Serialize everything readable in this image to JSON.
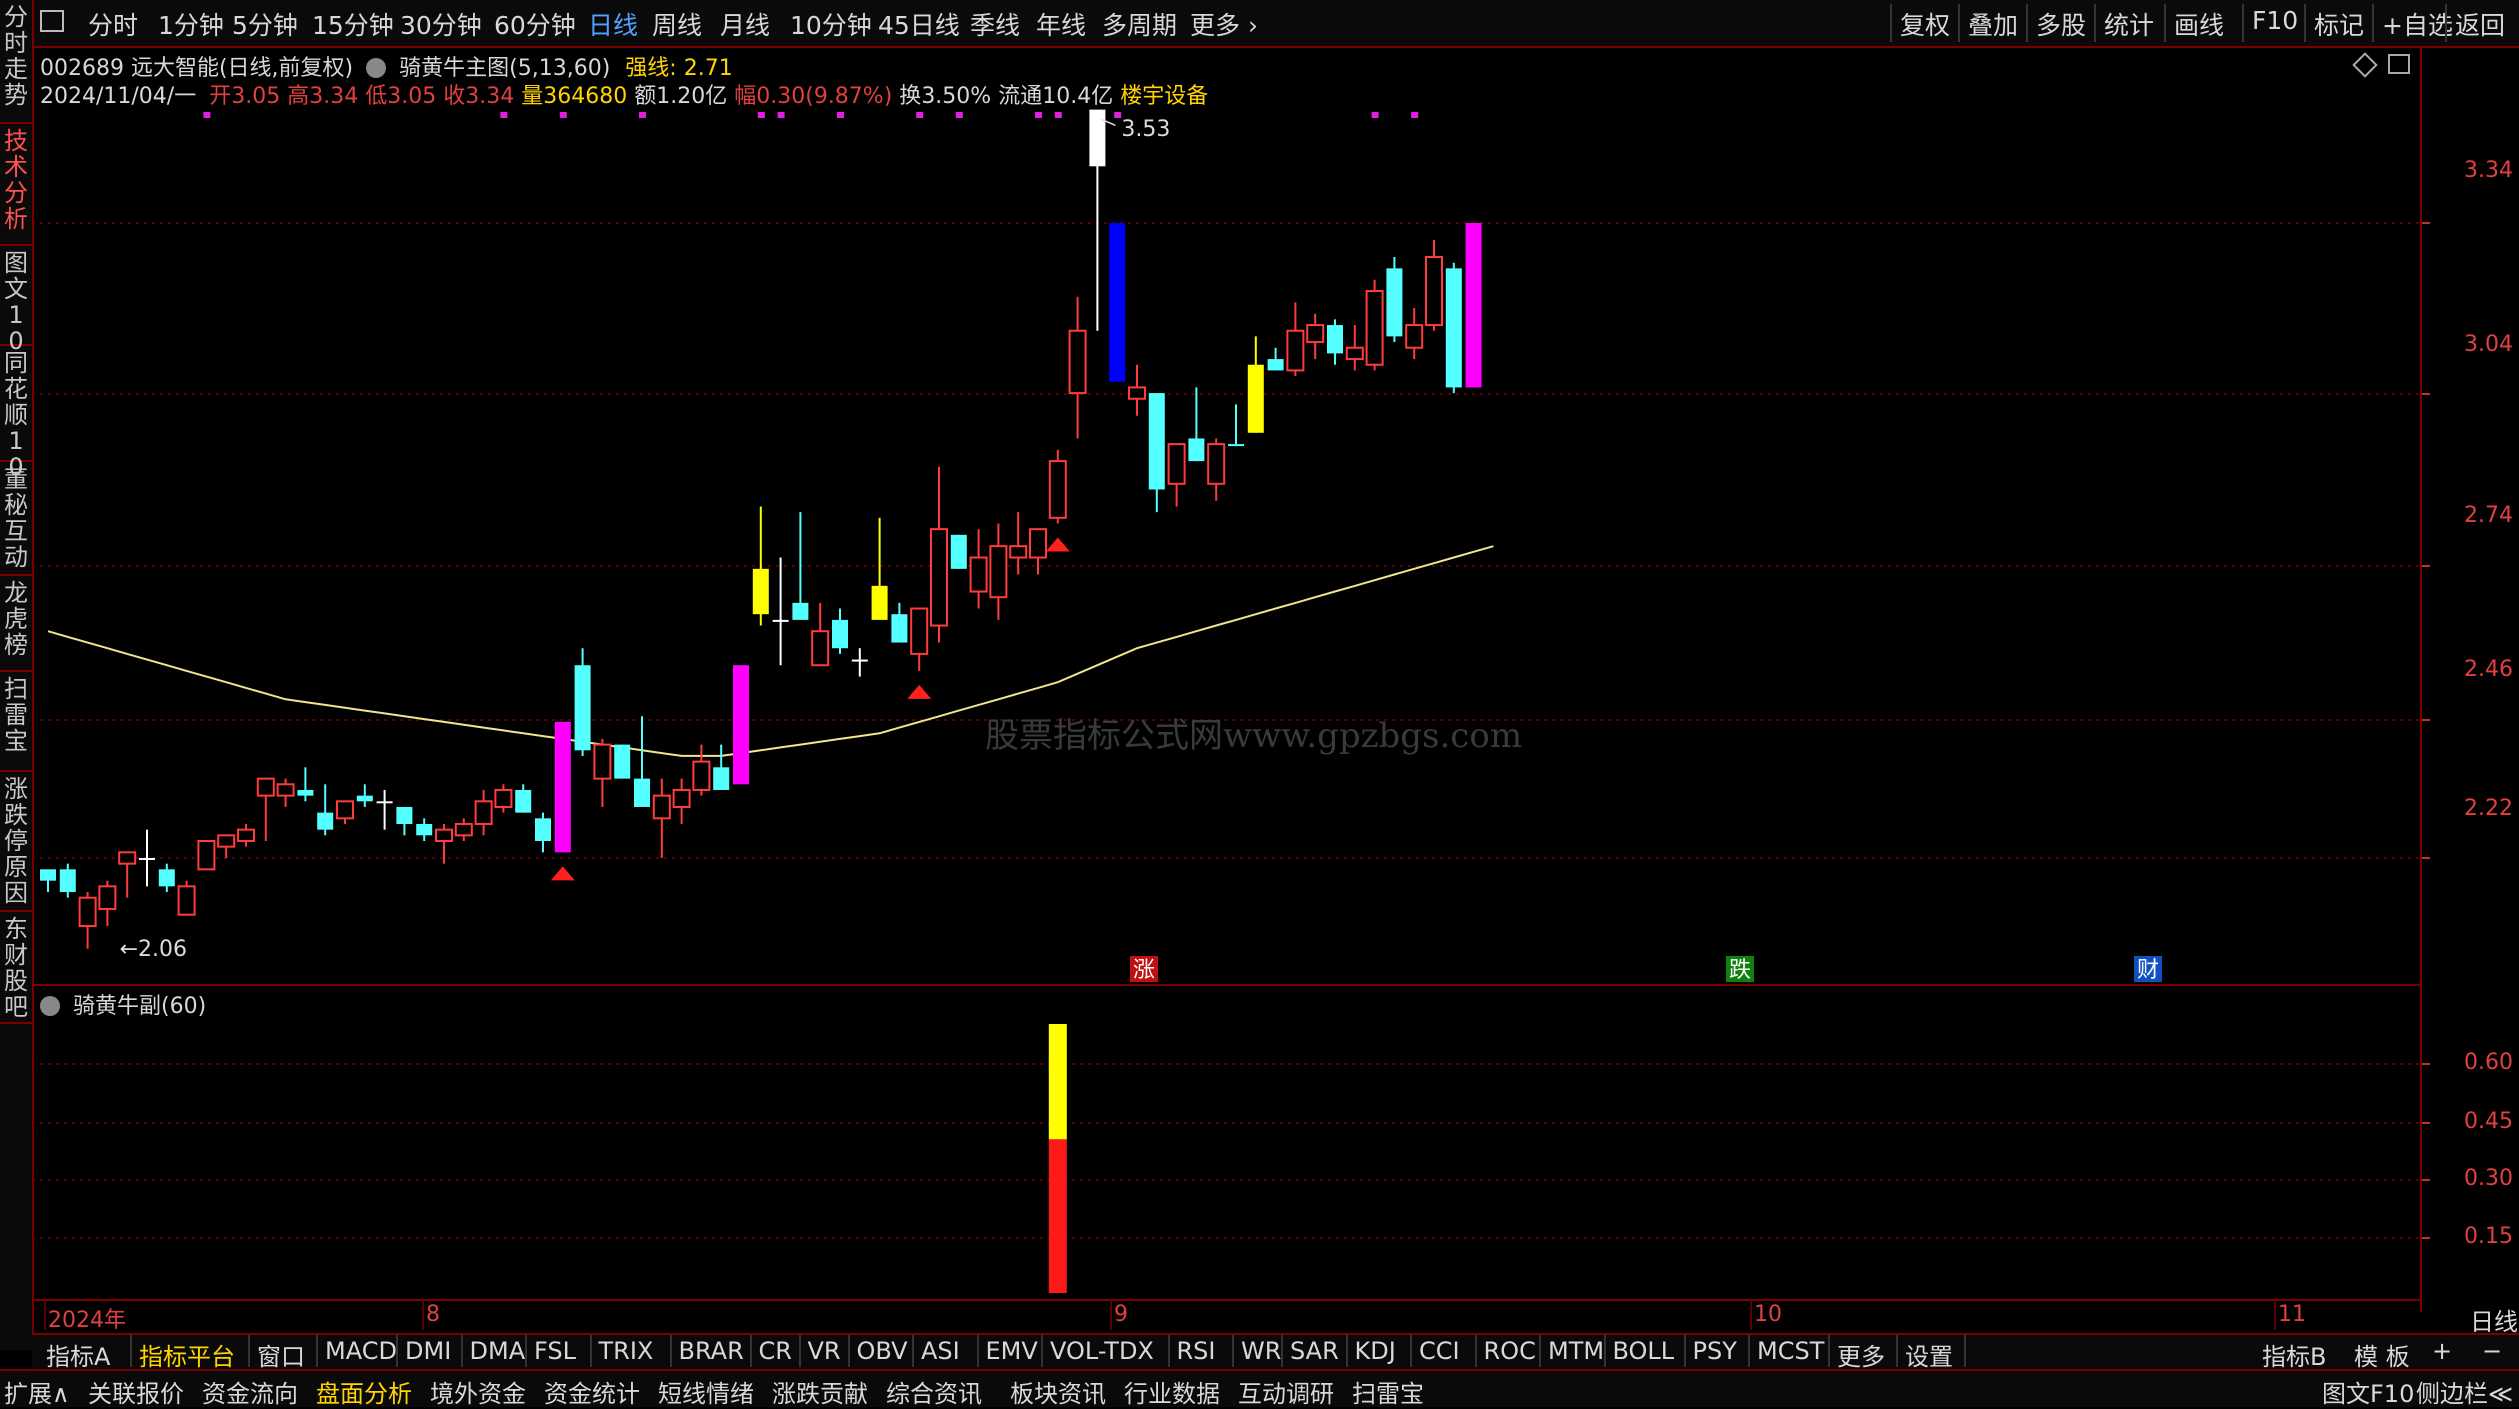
{
  "left_nav": [
    {
      "label": "分时走势",
      "active": false
    },
    {
      "label": "技术分析",
      "active": true
    },
    {
      "label": "图文10",
      "active": false
    },
    {
      "label": "同花顺10",
      "active": false
    },
    {
      "label": "董秘互动",
      "active": false
    },
    {
      "label": "龙虎榜",
      "active": false
    },
    {
      "label": "扫雷宝",
      "active": false
    },
    {
      "label": "涨跌停原因",
      "active": false
    },
    {
      "label": "东财股吧",
      "active": false
    }
  ],
  "periods": [
    "分时",
    "1分钟",
    "5分钟",
    "15分钟",
    "30分钟",
    "60分钟",
    "日线",
    "周线",
    "月线",
    "10分钟",
    "45日线",
    "季线",
    "年线",
    "多周期",
    "更多"
  ],
  "active_period": "日线",
  "right_tools": [
    "复权",
    "叠加",
    "多股",
    "统计",
    "画线",
    "F10",
    "标记",
    "+自选",
    "返回"
  ],
  "info1": {
    "code_name": "002689 远大智能(日线,前复权)",
    "indicator": "骑黄牛主图(5,13,60)",
    "strong_label": "强线:",
    "strong_value": "2.71"
  },
  "info2": {
    "date": "2024/11/04/一",
    "open_label": "开",
    "open": "3.05",
    "high_label": "高",
    "high": "3.34",
    "low_label": "低",
    "low": "3.05",
    "close_label": "收",
    "close": "3.34",
    "vol_label": "量",
    "vol": "364680",
    "amt_label": "额",
    "amt": "1.20亿",
    "chg_label": "幅",
    "chg": "0.30(9.87%)",
    "turn_label": "换",
    "turn": "3.50%",
    "float_label": "流通",
    "float": "10.4亿",
    "sector": "楼宇设备"
  },
  "price_axis": [
    "3.34",
    "3.04",
    "2.74",
    "2.46",
    "2.22"
  ],
  "high_marker": "3.53",
  "low_marker": "2.06",
  "watermark": "股票指标公式网www.gpzbgs.com",
  "event_tags": [
    {
      "label": "涨",
      "color": "#c01010"
    },
    {
      "label": "跌",
      "color": "#108010"
    },
    {
      "label": "财",
      "color": "#1050c0"
    }
  ],
  "sub_title": "骑黄牛副(60)",
  "sub_axis": [
    "0.60",
    "0.45",
    "0.30",
    "0.15"
  ],
  "time_axis": [
    "2024年",
    "8",
    "9",
    "10",
    "11"
  ],
  "time_axis_right": "日线",
  "chart_data": {
    "type": "candlestick",
    "title": "骑黄牛主图(5,13,60)",
    "ylim": [
      2.0,
      3.6
    ],
    "candles": [
      {
        "o": 2.18,
        "h": 2.2,
        "l": 2.16,
        "c": 2.2,
        "color": "cyan"
      },
      {
        "o": 2.2,
        "h": 2.21,
        "l": 2.15,
        "c": 2.16,
        "color": "cyan"
      },
      {
        "o": 2.1,
        "h": 2.16,
        "l": 2.06,
        "c": 2.15,
        "color": "red"
      },
      {
        "o": 2.13,
        "h": 2.18,
        "l": 2.1,
        "c": 2.17,
        "color": "red"
      },
      {
        "o": 2.21,
        "h": 2.23,
        "l": 2.15,
        "c": 2.23,
        "color": "red"
      },
      {
        "o": 2.22,
        "h": 2.27,
        "l": 2.17,
        "c": 2.22,
        "color": "white"
      },
      {
        "o": 2.2,
        "h": 2.21,
        "l": 2.16,
        "c": 2.17,
        "color": "cyan"
      },
      {
        "o": 2.12,
        "h": 2.18,
        "l": 2.12,
        "c": 2.17,
        "color": "red"
      },
      {
        "o": 2.2,
        "h": 2.25,
        "l": 2.2,
        "c": 2.25,
        "color": "red"
      },
      {
        "o": 2.24,
        "h": 2.26,
        "l": 2.22,
        "c": 2.26,
        "color": "red"
      },
      {
        "o": 2.25,
        "h": 2.28,
        "l": 2.24,
        "c": 2.27,
        "color": "red"
      },
      {
        "o": 2.33,
        "h": 2.36,
        "l": 2.25,
        "c": 2.36,
        "color": "red"
      },
      {
        "o": 2.33,
        "h": 2.36,
        "l": 2.31,
        "c": 2.35,
        "color": "red"
      },
      {
        "o": 2.34,
        "h": 2.38,
        "l": 2.32,
        "c": 2.33,
        "color": "cyan"
      },
      {
        "o": 2.3,
        "h": 2.35,
        "l": 2.26,
        "c": 2.27,
        "color": "cyan"
      },
      {
        "o": 2.29,
        "h": 2.32,
        "l": 2.28,
        "c": 2.32,
        "color": "red"
      },
      {
        "o": 2.33,
        "h": 2.35,
        "l": 2.31,
        "c": 2.32,
        "color": "cyan"
      },
      {
        "o": 2.32,
        "h": 2.34,
        "l": 2.27,
        "c": 2.32,
        "color": "white"
      },
      {
        "o": 2.31,
        "h": 2.31,
        "l": 2.26,
        "c": 2.28,
        "color": "cyan"
      },
      {
        "o": 2.28,
        "h": 2.29,
        "l": 2.25,
        "c": 2.26,
        "color": "cyan"
      },
      {
        "o": 2.25,
        "h": 2.28,
        "l": 2.21,
        "c": 2.27,
        "color": "red"
      },
      {
        "o": 2.26,
        "h": 2.29,
        "l": 2.25,
        "c": 2.28,
        "color": "red"
      },
      {
        "o": 2.28,
        "h": 2.34,
        "l": 2.26,
        "c": 2.32,
        "color": "red"
      },
      {
        "o": 2.31,
        "h": 2.35,
        "l": 2.3,
        "c": 2.34,
        "color": "red"
      },
      {
        "o": 2.34,
        "h": 2.35,
        "l": 2.3,
        "c": 2.3,
        "color": "cyan"
      },
      {
        "o": 2.29,
        "h": 2.3,
        "l": 2.23,
        "c": 2.25,
        "color": "cyan"
      },
      {
        "o": 2.23,
        "h": 2.46,
        "l": 2.23,
        "c": 2.46,
        "color": "magenta"
      },
      {
        "o": 2.56,
        "h": 2.59,
        "l": 2.4,
        "c": 2.41,
        "color": "cyan"
      },
      {
        "o": 2.36,
        "h": 2.43,
        "l": 2.31,
        "c": 2.42,
        "color": "red"
      },
      {
        "o": 2.42,
        "h": 2.42,
        "l": 2.36,
        "c": 2.36,
        "color": "cyan"
      },
      {
        "o": 2.36,
        "h": 2.47,
        "l": 2.31,
        "c": 2.31,
        "color": "cyan"
      },
      {
        "o": 2.29,
        "h": 2.36,
        "l": 2.22,
        "c": 2.33,
        "color": "red"
      },
      {
        "o": 2.31,
        "h": 2.36,
        "l": 2.28,
        "c": 2.34,
        "color": "red"
      },
      {
        "o": 2.34,
        "h": 2.42,
        "l": 2.33,
        "c": 2.39,
        "color": "red"
      },
      {
        "o": 2.38,
        "h": 2.42,
        "l": 2.36,
        "c": 2.34,
        "color": "cyan"
      },
      {
        "o": 2.35,
        "h": 2.56,
        "l": 2.35,
        "c": 2.56,
        "color": "magenta"
      },
      {
        "o": 2.73,
        "h": 2.84,
        "l": 2.63,
        "c": 2.65,
        "color": "yellow"
      },
      {
        "o": 2.64,
        "h": 2.75,
        "l": 2.56,
        "c": 2.64,
        "color": "white"
      },
      {
        "o": 2.67,
        "h": 2.83,
        "l": 2.64,
        "c": 2.64,
        "color": "cyan"
      },
      {
        "o": 2.56,
        "h": 2.67,
        "l": 2.56,
        "c": 2.62,
        "color": "red"
      },
      {
        "o": 2.64,
        "h": 2.66,
        "l": 2.58,
        "c": 2.59,
        "color": "cyan"
      },
      {
        "o": 2.57,
        "h": 2.59,
        "l": 2.54,
        "c": 2.57,
        "color": "white"
      },
      {
        "o": 2.7,
        "h": 2.82,
        "l": 2.65,
        "c": 2.64,
        "color": "yellow"
      },
      {
        "o": 2.65,
        "h": 2.67,
        "l": 2.6,
        "c": 2.6,
        "color": "cyan"
      },
      {
        "o": 2.58,
        "h": 2.66,
        "l": 2.55,
        "c": 2.66,
        "color": "red"
      },
      {
        "o": 2.63,
        "h": 2.91,
        "l": 2.6,
        "c": 2.8,
        "color": "red"
      },
      {
        "o": 2.79,
        "h": 2.79,
        "l": 2.73,
        "c": 2.73,
        "color": "cyan"
      },
      {
        "o": 2.69,
        "h": 2.8,
        "l": 2.66,
        "c": 2.75,
        "color": "red"
      },
      {
        "o": 2.68,
        "h": 2.81,
        "l": 2.64,
        "c": 2.77,
        "color": "red"
      },
      {
        "o": 2.75,
        "h": 2.83,
        "l": 2.72,
        "c": 2.77,
        "color": "red"
      },
      {
        "o": 2.75,
        "h": 2.8,
        "l": 2.72,
        "c": 2.8,
        "color": "red"
      },
      {
        "o": 2.82,
        "h": 2.94,
        "l": 2.81,
        "c": 2.92,
        "color": "red"
      },
      {
        "o": 3.04,
        "h": 3.21,
        "l": 2.96,
        "c": 3.15,
        "color": "red"
      },
      {
        "o": 3.44,
        "h": 3.53,
        "l": 3.15,
        "c": 3.54,
        "color": "white"
      },
      {
        "o": 3.34,
        "h": 3.34,
        "l": 3.06,
        "c": 3.06,
        "color": "blue"
      },
      {
        "o": 3.03,
        "h": 3.09,
        "l": 3.0,
        "c": 3.05,
        "color": "red"
      },
      {
        "o": 3.04,
        "h": 3.04,
        "l": 2.83,
        "c": 2.87,
        "color": "cyan"
      },
      {
        "o": 2.88,
        "h": 2.95,
        "l": 2.84,
        "c": 2.95,
        "color": "red"
      },
      {
        "o": 2.96,
        "h": 3.05,
        "l": 2.92,
        "c": 2.92,
        "color": "cyan"
      },
      {
        "o": 2.88,
        "h": 2.96,
        "l": 2.85,
        "c": 2.95,
        "color": "red"
      },
      {
        "o": 2.95,
        "h": 3.02,
        "l": 2.95,
        "c": 2.95,
        "color": "cyan"
      },
      {
        "o": 2.97,
        "h": 3.14,
        "l": 2.97,
        "c": 3.09,
        "color": "yellow"
      },
      {
        "o": 3.1,
        "h": 3.12,
        "l": 3.08,
        "c": 3.08,
        "color": "cyan"
      },
      {
        "o": 3.08,
        "h": 3.2,
        "l": 3.07,
        "c": 3.15,
        "color": "red"
      },
      {
        "o": 3.13,
        "h": 3.18,
        "l": 3.1,
        "c": 3.16,
        "color": "red"
      },
      {
        "o": 3.16,
        "h": 3.17,
        "l": 3.09,
        "c": 3.11,
        "color": "cyan"
      },
      {
        "o": 3.1,
        "h": 3.16,
        "l": 3.08,
        "c": 3.12,
        "color": "red"
      },
      {
        "o": 3.09,
        "h": 3.24,
        "l": 3.08,
        "c": 3.22,
        "color": "red"
      },
      {
        "o": 3.26,
        "h": 3.28,
        "l": 3.13,
        "c": 3.14,
        "color": "cyan"
      },
      {
        "o": 3.12,
        "h": 3.19,
        "l": 3.1,
        "c": 3.16,
        "color": "red"
      },
      {
        "o": 3.16,
        "h": 3.31,
        "l": 3.15,
        "c": 3.28,
        "color": "red"
      },
      {
        "o": 3.26,
        "h": 3.27,
        "l": 3.04,
        "c": 3.05,
        "color": "cyan"
      },
      {
        "o": 3.05,
        "h": 3.34,
        "l": 3.05,
        "c": 3.34,
        "color": "magenta"
      }
    ],
    "ma60": [
      2.62,
      2.61,
      2.6,
      2.59,
      2.58,
      2.57,
      2.56,
      2.55,
      2.54,
      2.53,
      2.52,
      2.51,
      2.5,
      2.495,
      2.49,
      2.485,
      2.48,
      2.475,
      2.47,
      2.465,
      2.46,
      2.455,
      2.45,
      2.445,
      2.44,
      2.435,
      2.43,
      2.425,
      2.42,
      2.415,
      2.41,
      2.405,
      2.4,
      2.4,
      2.4,
      2.405,
      2.41,
      2.415,
      2.42,
      2.425,
      2.43,
      2.435,
      2.44,
      2.45,
      2.46,
      2.47,
      2.48,
      2.49,
      2.5,
      2.51,
      2.52,
      2.53,
      2.545,
      2.56,
      2.575,
      2.59,
      2.6,
      2.61,
      2.62,
      2.63,
      2.64,
      2.65,
      2.66,
      2.67,
      2.68,
      2.69,
      2.7,
      2.71,
      2.72,
      2.73,
      2.74,
      2.75,
      2.76,
      2.77
    ],
    "buy_markers": [
      26,
      44,
      51
    ],
    "signal_dots": [
      8,
      23,
      26,
      30,
      36,
      37,
      40,
      44,
      46,
      50,
      51,
      54,
      67,
      69
    ],
    "sub_chart": {
      "ylim": [
        0,
        0.7
      ],
      "bar_index": 51,
      "lower_value": 0.4,
      "lower_color": "red",
      "upper_value": 0.7,
      "upper_color": "yellow"
    }
  },
  "indicator_tabs": [
    "指标A",
    "指标平台",
    "窗口",
    "MACD",
    "DMI",
    "DMA",
    "FSL",
    "TRIX",
    "BRAR",
    "CR",
    "VR",
    "OBV",
    "ASI",
    "EMV",
    "VOL-TDX",
    "RSI",
    "WR",
    "SAR",
    "KDJ",
    "CCI",
    "ROC",
    "MTM",
    "BOLL",
    "PSY",
    "MCST",
    "更多",
    "设置"
  ],
  "active_indicator_tab": "指标平台",
  "indicator_tabs_right": [
    "指标B",
    "模 板",
    "+",
    "−"
  ],
  "bottom_tabs": [
    "扩展∧",
    "关联报价",
    "资金流向",
    "盘面分析",
    "境外资金",
    "资金统计",
    "短线情绪",
    "涨跌贡献",
    "综合资讯",
    "板块资讯",
    "行业数据",
    "互动调研",
    "扫雷宝"
  ],
  "active_bottom_tab": "盘面分析",
  "bottom_right": [
    "图文F10",
    "侧边栏≪"
  ]
}
